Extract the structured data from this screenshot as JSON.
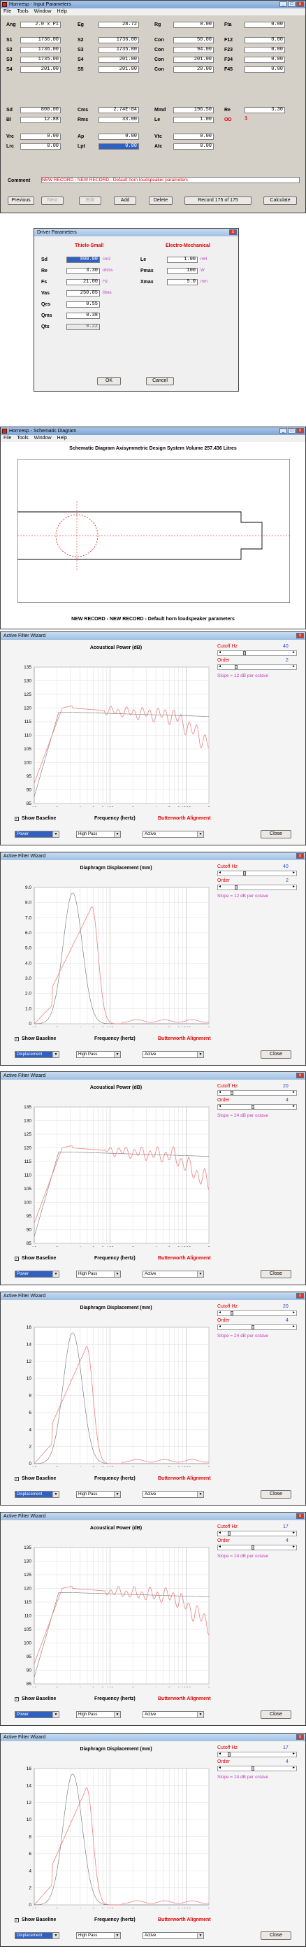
{
  "input_win": {
    "title": "Hornresp - Input Parameters",
    "menus": [
      "File",
      "Tools",
      "Window",
      "Help"
    ],
    "params": [
      {
        "name": "Ang",
        "value": "2.0 x Pi"
      },
      {
        "name": "Eg",
        "value": "28.72"
      },
      {
        "name": "Rg",
        "value": "0.00"
      },
      {
        "name": "Fta",
        "value": "0.00"
      },
      {
        "name": "S1",
        "value": "1736.00"
      },
      {
        "name": "S2",
        "value": "1736.00"
      },
      {
        "name": "Con",
        "value": "50.00"
      },
      {
        "name": "F12",
        "value": "0.00"
      },
      {
        "name": "S2",
        "value": "1736.00"
      },
      {
        "name": "S3",
        "value": "1735.00"
      },
      {
        "name": "Con",
        "value": "94.00"
      },
      {
        "name": "F23",
        "value": "0.00"
      },
      {
        "name": "S3",
        "value": "1735.00"
      },
      {
        "name": "S4",
        "value": "201.00"
      },
      {
        "name": "Con",
        "value": "201.00"
      },
      {
        "name": "F34",
        "value": "0.00"
      },
      {
        "name": "S4",
        "value": "201.00"
      },
      {
        "name": "S5",
        "value": "201.00"
      },
      {
        "name": "Con",
        "value": "20.00"
      },
      {
        "name": "F45",
        "value": "0.00"
      },
      {
        "name": "Sd",
        "value": "800.00"
      },
      {
        "name": "Cms",
        "value": "2.74E-04"
      },
      {
        "name": "Mmd",
        "value": "196.50"
      },
      {
        "name": "Re",
        "value": "3.30"
      },
      {
        "name": "Bl",
        "value": "12.88"
      },
      {
        "name": "Rms",
        "value": "33.00"
      },
      {
        "name": "Le",
        "value": "1.00"
      },
      {
        "name": "OD",
        "value": "1"
      },
      {
        "name": "Vrc",
        "value": "0.00"
      },
      {
        "name": "Ap",
        "value": "0.00"
      },
      {
        "name": "Vtc",
        "value": "0.00"
      },
      {
        "name": "Lrc",
        "value": "0.00"
      },
      {
        "name": "Lpt",
        "value": "0.00"
      },
      {
        "name": "Atc",
        "value": "0.00"
      }
    ],
    "comment_label": "Comment",
    "comment": "NEW RECORD - NEW RECORD - Default horn loudspeaker parameters",
    "buttons": {
      "previous": "Previous",
      "next": "Next",
      "edit": "Edit",
      "add": "Add",
      "delete": "Delete",
      "record": "Record 175 of 175",
      "calculate": "Calculate"
    }
  },
  "driver_win": {
    "title": "Driver Parameters",
    "left_header": "Thiele-Small",
    "right_header": "Electro-Mechanical",
    "left": [
      {
        "name": "Sd",
        "value": "800.00",
        "unit": "cm2"
      },
      {
        "name": "Re",
        "value": "3.30",
        "unit": "ohms"
      },
      {
        "name": "Fs",
        "value": "21.00",
        "unit": "Hz"
      },
      {
        "name": "Vas",
        "value": "250.85",
        "unit": "litres"
      },
      {
        "name": "Qes",
        "value": "0.55",
        "unit": ""
      },
      {
        "name": "Qms",
        "value": "0.38",
        "unit": ""
      },
      {
        "name": "Qts",
        "value": "0.22",
        "unit": ""
      }
    ],
    "right": [
      {
        "name": "Le",
        "value": "1.00",
        "unit": "mH"
      },
      {
        "name": "Pmax",
        "value": "100",
        "unit": "W"
      },
      {
        "name": "Xmax",
        "value": "5.0",
        "unit": "mm"
      }
    ],
    "ok": "OK",
    "cancel": "Cancel"
  },
  "schem_win": {
    "title": "Hornresp - Schematic Diagram",
    "menus": [
      "File",
      "Tools",
      "Window",
      "Help"
    ],
    "heading": "Schematic Diagram   Axisymmetric Design   System Volume 257.436 Litres",
    "caption": "NEW RECORD - NEW RECORD - Default horn loudspeaker parameters"
  },
  "filter_common": {
    "title": "Active Filter Wizard",
    "cutoff_label": "Cutoff Hz",
    "order_label": "Order",
    "show_baseline": "Show Baseline",
    "freq_label": "Frequency (hertz)",
    "alignment": "Butterworth Alignment",
    "pass_value": "High Pass",
    "active_value": "Active",
    "close": "Close",
    "x_ticks": [
      "10",
      "2",
      "4",
      "6",
      "8",
      "100",
      "2",
      "4",
      "6",
      "8",
      "1000",
      "2"
    ]
  },
  "filters": [
    {
      "heading": "Acoustical Power (dB)",
      "cutoff": "40",
      "order": "2",
      "slope": "Slope = 12 dB per octave",
      "mode": "Power",
      "y_ticks": [
        "135",
        "130",
        "125",
        "120",
        "115",
        "110",
        "105",
        "100",
        "95",
        "90",
        "85"
      ]
    },
    {
      "heading": "Diaphragm Displacement (mm)",
      "cutoff": "40",
      "order": "2",
      "slope": "Slope = 12 dB per octave",
      "mode": "Displacement",
      "y_ticks": [
        "9.0",
        "8.0",
        "7.0",
        "6.0",
        "5.0",
        "4.0",
        "3.0",
        "2.0",
        "1.0",
        "0"
      ]
    },
    {
      "heading": "Acoustical Power (dB)",
      "cutoff": "20",
      "order": "4",
      "slope": "Slope = 24 dB per octave",
      "mode": "Power",
      "y_ticks": [
        "135",
        "130",
        "125",
        "120",
        "115",
        "110",
        "105",
        "100",
        "95",
        "90",
        "85"
      ]
    },
    {
      "heading": "Diaphragm Displacement (mm)",
      "cutoff": "20",
      "order": "4",
      "slope": "Slope = 24 dB per octave",
      "mode": "Displacement",
      "y_ticks": [
        "16",
        "14",
        "12",
        "10",
        "8",
        "6",
        "4",
        "2",
        "0"
      ]
    },
    {
      "heading": "Acoustical Power (dB)",
      "cutoff": "17",
      "order": "4",
      "slope": "Slope = 24 dB per octave",
      "mode": "Power",
      "y_ticks": [
        "135",
        "130",
        "125",
        "120",
        "115",
        "110",
        "105",
        "100",
        "95",
        "90",
        "85"
      ]
    },
    {
      "heading": "Diaphragm Displacement (mm)",
      "cutoff": "17",
      "order": "4",
      "slope": "Slope = 24 dB per octave",
      "mode": "Displacement",
      "y_ticks": [
        "16",
        "14",
        "12",
        "10",
        "8",
        "6",
        "4",
        "2",
        "0"
      ]
    }
  ],
  "colors": {
    "curve": "#f08080",
    "baseline": "#707070",
    "accent": "#e00000",
    "slope": "#c040c0",
    "selection": "#3060c0"
  }
}
